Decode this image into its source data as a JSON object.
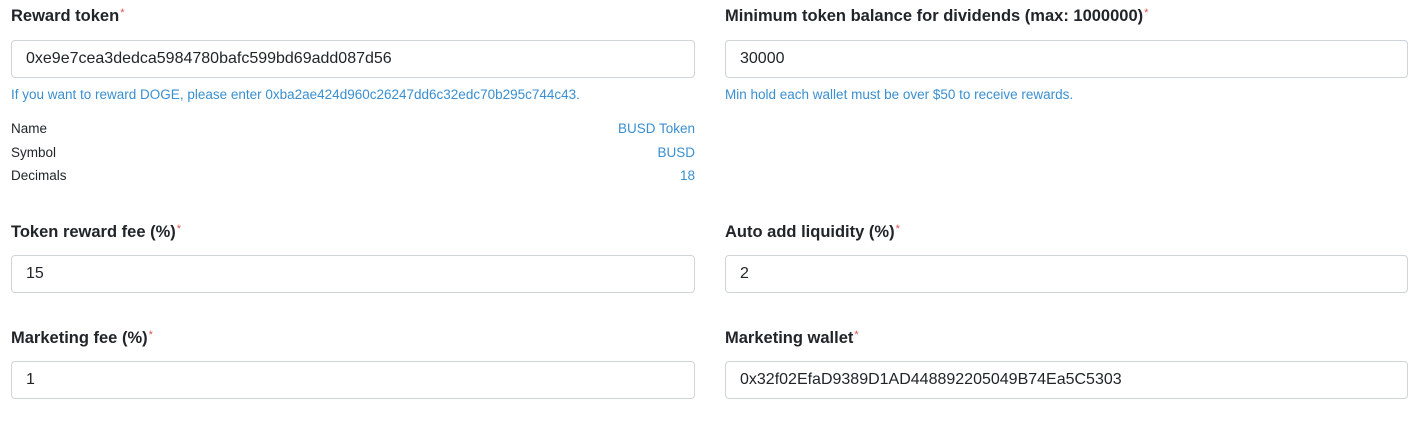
{
  "reward_token": {
    "label": "Reward token",
    "required_mark": "*",
    "value": "0xe9e7cea3dedca5984780bafc599bd69add087d56",
    "hint": "If you want to reward DOGE, please enter 0xba2ae424d960c26247dd6c32edc70b295c744c43.",
    "info": [
      {
        "key": "Name",
        "value": "BUSD Token"
      },
      {
        "key": "Symbol",
        "value": "BUSD"
      },
      {
        "key": "Decimals",
        "value": "18"
      }
    ]
  },
  "min_balance": {
    "label": "Minimum token balance for dividends (max: 1000000)",
    "required_mark": "*",
    "value": "30000",
    "hint": "Min hold each wallet must be over $50 to receive rewards."
  },
  "token_reward_fee": {
    "label": "Token reward fee (%)",
    "required_mark": "*",
    "value": "15"
  },
  "auto_liquidity": {
    "label": "Auto add liquidity (%)",
    "required_mark": "*",
    "value": "2"
  },
  "marketing_fee": {
    "label": "Marketing fee (%)",
    "required_mark": "*",
    "value": "1"
  },
  "marketing_wallet": {
    "label": "Marketing wallet",
    "required_mark": "*",
    "value": "0x32f02EfaD9389D1AD448892205049B74Ea5C5303"
  },
  "colors": {
    "hint_blue": "#3a8fd0",
    "required_red": "#e0534f",
    "input_border": "#ced4da"
  }
}
